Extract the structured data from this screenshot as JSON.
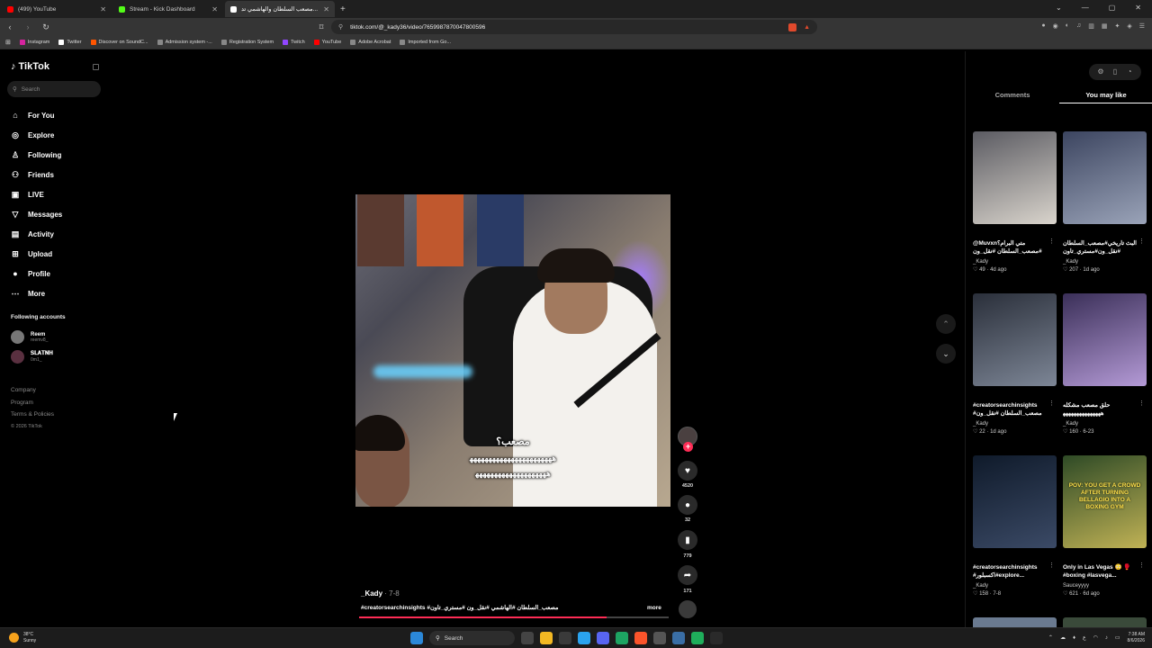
{
  "browser": {
    "tabs": [
      {
        "title": "(499) YouTube",
        "color": "#ff0000",
        "active": false
      },
      {
        "title": "Stream - Kick Dashboard",
        "color": "#53fc18",
        "active": false
      },
      {
        "title": "مصعب السلطان والهاشمي تد...",
        "color": "#ffffff",
        "active": true
      }
    ],
    "url": "tiktok.com/@_kady36/video/7659987870047800596",
    "bookmarks": [
      {
        "label": "Instagram",
        "color": "#d6249f"
      },
      {
        "label": "Twitter",
        "color": "#ffffff"
      },
      {
        "label": "Discover on SoundC...",
        "color": "#ff5500"
      },
      {
        "label": "Admission system -...",
        "color": "#888888"
      },
      {
        "label": "Registration System",
        "color": "#888888"
      },
      {
        "label": "Twitch",
        "color": "#9146ff"
      },
      {
        "label": "YouTube",
        "color": "#ff0000"
      },
      {
        "label": "Adobe Acrobat",
        "color": "#888888"
      },
      {
        "label": "Imported from Go...",
        "color": "#888888"
      }
    ]
  },
  "tiktok": {
    "logo": "TikTok",
    "search_placeholder": "Search",
    "nav": [
      {
        "label": "For You",
        "icon": "home-icon",
        "glyph": "⌂"
      },
      {
        "label": "Explore",
        "icon": "compass-icon",
        "glyph": "◎"
      },
      {
        "label": "Following",
        "icon": "user-check-icon",
        "glyph": "♙"
      },
      {
        "label": "Friends",
        "icon": "friends-icon",
        "glyph": "⚇"
      },
      {
        "label": "LIVE",
        "icon": "live-icon",
        "glyph": "▣"
      },
      {
        "label": "Messages",
        "icon": "send-icon",
        "glyph": "▽"
      },
      {
        "label": "Activity",
        "icon": "activity-icon",
        "glyph": "▤"
      },
      {
        "label": "Upload",
        "icon": "upload-icon",
        "glyph": "⊞"
      },
      {
        "label": "Profile",
        "icon": "profile-icon",
        "glyph": "●"
      },
      {
        "label": "More",
        "icon": "more-icon",
        "glyph": "⋯"
      }
    ],
    "following_title": "Following accounts",
    "following": [
      {
        "name": "Reem",
        "handle": "reemv8_"
      },
      {
        "name": "𝐒𝐋𝐀𝐓𝐍𝐇",
        "handle": "0m1_"
      }
    ],
    "footer": {
      "company": "Company",
      "program": "Program",
      "terms": "Terms & Policies",
      "copyright": "© 2026 TikTok"
    }
  },
  "video": {
    "caption_line1": "مصعب؟",
    "caption_line2": "ﻫﻬﻬﻬﻬﻬﻬﻬﻬﻬﻬﻬﻬﻬﻬﻬﻬﻬﻬﻬﻬﻬﻬ",
    "caption_line3": "ﻫﻬﻬﻬﻬﻬﻬﻬﻬﻬﻬﻬﻬﻬﻬﻬﻬﻬﻬﻬ",
    "author": "_Kady",
    "date": " · 7-8",
    "description": "#creatorsearchinsights #مصعب_السلطان #الهاشمي #نقل_ون #مستري_تاون",
    "more_label": "more",
    "progress": 0.8,
    "likes": "4520",
    "comments": "32",
    "saves": "779",
    "shares": "171"
  },
  "right_panel": {
    "tabs": [
      "Comments",
      "You may like"
    ],
    "active_tab": 1,
    "cards": [
      {
        "title": "@Muvxnمتي البرام؟ #مصعب_السلطان #نقل_ون",
        "author": "_Kady",
        "likes": "49",
        "date": "4d ago",
        "c1": "#5b5b62",
        "c2": "#d9d4cc"
      },
      {
        "title": "البث تاريخي#مصعب_السلطان #نقل_ون#مستري_تاون",
        "author": "_Kady",
        "likes": "207",
        "date": "1d ago",
        "c1": "#3c4560",
        "c2": "#9aa3b8"
      },
      {
        "title": "#creatorsearchinsights #مصعب_السلطان #نقل_ون",
        "author": "_Kady",
        "likes": "22",
        "date": "1d ago",
        "c1": "#2a2f3a",
        "c2": "#7d8696"
      },
      {
        "title": "حلق مصعب مشكله ﻫﻬﻬﻬﻬﻬﻬﻬﻬﻬﻬﻬﻬﻬﻬ",
        "author": "_Kady",
        "likes": "160",
        "date": "6-23",
        "c1": "#3a2f58",
        "c2": "#b49ad6"
      },
      {
        "title": "#creatorsearchinsights #اكسبلور#explore...",
        "author": "_Kady",
        "likes": "158",
        "date": "7-8",
        "c1": "#0f1a2a",
        "c2": "#3b4a66"
      },
      {
        "title": "Only in Las Vegas 😳 🥊 #boxing #lasvega...",
        "author": "Sauceyyyy",
        "likes": "621",
        "date": "6d ago",
        "c1": "#2e4a26",
        "c2": "#c0b255"
      }
    ],
    "vegas_overlay": "POV: YOU GET A CROWD AFTER TURNING BELLAGIO INTO A BOXING GYM"
  },
  "taskbar": {
    "temp": "38°C",
    "condition": "Sunny",
    "search": "Search",
    "time": "7:38 AM",
    "date": "8/6/2026"
  }
}
